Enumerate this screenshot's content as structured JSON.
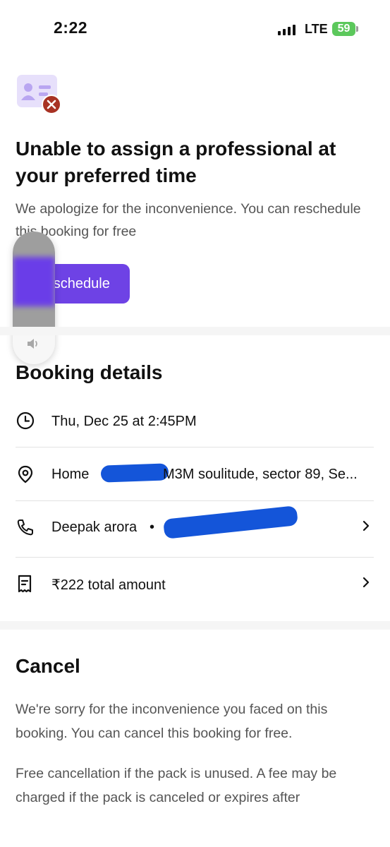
{
  "status_bar": {
    "time": "2:22",
    "network": "LTE",
    "battery": "59"
  },
  "alert": {
    "icon": "id-card-error-icon",
    "title": "Unable to assign a professional at your preferred time",
    "subtitle": "We apologize for the inconvenience. You can reschedule this booking for free",
    "button_label": "Reschedule"
  },
  "volume_overlay": {
    "icon": "speaker-icon"
  },
  "booking_details": {
    "title": "Booking details",
    "datetime": "Thu, Dec 25 at 2:45PM",
    "address_label": "Home",
    "address": "M3M soulitude, sector 89, Se...",
    "contact_name": "Deepak arora",
    "contact_separator": "•",
    "amount": "₹222 total amount"
  },
  "cancel": {
    "title": "Cancel",
    "paragraph1": "We're sorry for the inconvenience you faced on this booking. You can cancel this booking for free.",
    "paragraph2": "Free cancellation if the pack is unused. A fee may be charged if the pack is canceled or expires after"
  },
  "colors": {
    "accent": "#6e42e5",
    "error": "#a83224",
    "battery": "#5cc85c",
    "redaction": "#1455d9"
  }
}
